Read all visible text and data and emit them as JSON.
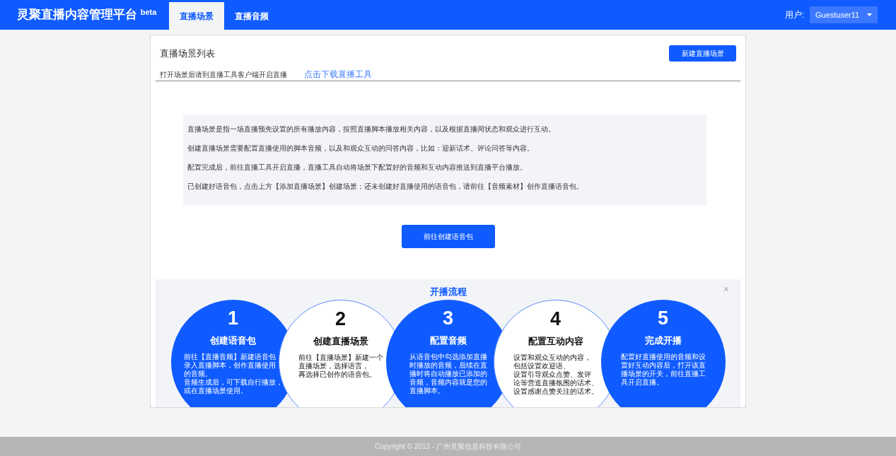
{
  "brand": {
    "title": "灵聚直播内容管理平台",
    "badge": "beta"
  },
  "nav_tabs": [
    {
      "label": "直播场景",
      "selected": true
    },
    {
      "label": "直播音频",
      "selected": false
    }
  ],
  "user": {
    "label": "用户:",
    "name": "Guestuser11"
  },
  "card": {
    "title": "直播场景列表",
    "subtitle": "打开场景后请到直播工具客户端开启直播",
    "link": "点击下载直播工具",
    "new_button": "新建直播场景"
  },
  "intro": [
    "直播场景是指一场直播预先设置的所有播放内容，按照直播脚本播放相关内容，以及根据直播间状态和观众进行互动。",
    "创建直播场景需要配置直播使用的脚本音频，以及和观众互动的问答内容，比如：迎新话术、评论问答等内容。",
    "配置完成后，前往直播工具开启直播，直播工具自动将场景下配置好的音频和互动内容推送到直播平台播放。",
    "已创建好语音包，点击上方【添加直播场景】创建场景；还未创建好直播使用的语音包，请前往【音频素材】创作直播语音包。"
  ],
  "create_button": "前往创建语音包",
  "flow": {
    "title": "开播流程",
    "close": "×",
    "steps": [
      {
        "number": "1",
        "title": "创建语音包",
        "kind": "filled",
        "lines": [
          "前往【直播音频】新建语音包，",
          "录入直播脚本，创作直播使用",
          "的音频。",
          "音频生成后，可下载自行播放，",
          "或在直播场景使用。"
        ]
      },
      {
        "number": "2",
        "title": "创建直播场景",
        "kind": "outlined",
        "lines": [
          "前往【直播场景】新建一个",
          "直播场景，选择语言，",
          "再选择已创作的语音包。"
        ]
      },
      {
        "number": "3",
        "title": "配置音频",
        "kind": "filled",
        "lines": [
          "从语音包中勾选添加直播",
          "时播放的音频，后续在直",
          "播时将自动播放已添加的",
          "音频，音频内容就是您的",
          "直播脚本。"
        ]
      },
      {
        "number": "4",
        "title": "配置互动内容",
        "kind": "outlined",
        "lines": [
          "设置和观众互动的内容，",
          "包括设置欢迎语、",
          "设置引导观众点赞、发评",
          "论等营造直播氛围的话术、",
          "设置感谢点赞关注的话术。"
        ]
      },
      {
        "number": "5",
        "title": "完成开播",
        "kind": "filled",
        "lines": [
          "配置好直播使用的音频和设",
          "置好互动内容后，打开该直",
          "播场景的开关，前往直播工",
          "具开启直播。"
        ]
      }
    ]
  },
  "footer": "Copyright © 2013 - 广州灵聚信息科技有限公司"
}
